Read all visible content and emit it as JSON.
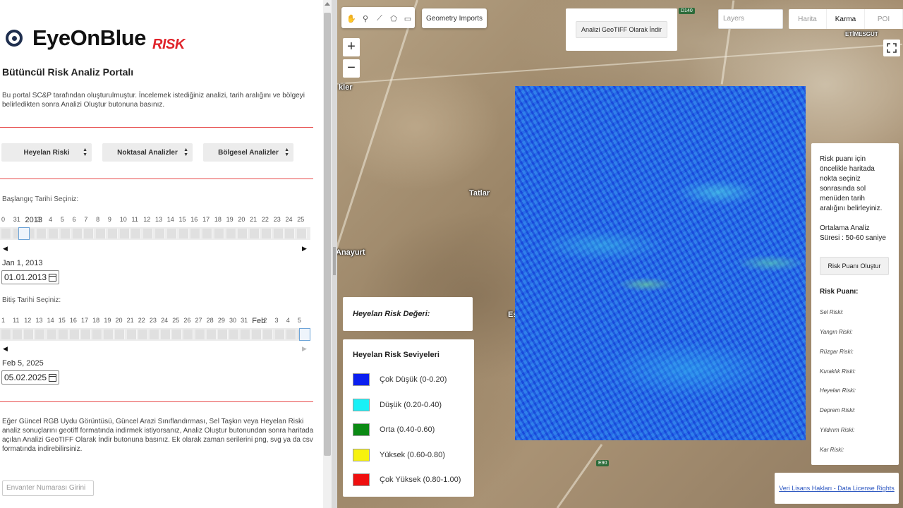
{
  "brand": {
    "name": "EyeOnBlue",
    "suffix": "RISK"
  },
  "portal": {
    "title": "Bütüncül Risk Analiz Portalı",
    "description": "Bu portal SC&P tarafından oluşturulmuştur. İncelemek istediğiniz analizi, tarih aralığını ve bölgeyi belirledikten sonra Analizi Oluştur butonuna basınız."
  },
  "dropdowns": [
    "Heyelan Riski",
    "Noktasal Analizler",
    "Bölgesel Analizler"
  ],
  "start": {
    "label": "Başlangıç Tarihi Seçiniz:",
    "ticks": [
      "0",
      "31",
      "2013",
      "3",
      "4",
      "5",
      "6",
      "7",
      "8",
      "9",
      "10",
      "11",
      "12",
      "13",
      "14",
      "15",
      "16",
      "17",
      "18",
      "19",
      "20",
      "21",
      "22",
      "23",
      "24",
      "25"
    ],
    "selected": "Jan 1, 2013",
    "input_value": "01.01.2013"
  },
  "end": {
    "label": "Bitiş Tarihi Seçiniz:",
    "ticks": [
      "1",
      "11",
      "12",
      "13",
      "14",
      "15",
      "16",
      "17",
      "18",
      "19",
      "20",
      "21",
      "22",
      "23",
      "24",
      "25",
      "26",
      "27",
      "28",
      "29",
      "30",
      "31",
      "Feb",
      "2",
      "3",
      "4",
      "5"
    ],
    "selected": "Feb 5, 2025",
    "input_value": "05.02.2025"
  },
  "footer_text": "Eğer Güncel RGB Uydu Görüntüsü, Güncel Arazi Sınıflandırması, Sel Taşkın veya Heyelan Riski analiz sonuçlarını geotiff formatında indirmek istiyorsanız, Analiz Oluştur butonundan sonra haritada açılan Analizi GeoTIFF Olarak İndir butonuna basınız. Ek olarak zaman serilerini png, svg ya da csv formatında indirebilirsiniz.",
  "inventory_placeholder": "Envanter Numarası Girini",
  "map": {
    "geometry_imports": "Geometry Imports",
    "geotiff_button": "Analizi GeoTIFF Olarak İndir",
    "layers_placeholder": "Layers",
    "basemaps": [
      "Harita",
      "Karma",
      "POI"
    ],
    "active_basemap": "Karma",
    "zoom_in": "+",
    "zoom_out": "−",
    "places": [
      "kler",
      "Tatlar",
      "Anayurt",
      "Es",
      "ETİMESGUT"
    ],
    "road_badges": [
      "D140",
      "E90"
    ],
    "license_link": "Veri Lisans Hakları - Data License Rights"
  },
  "legend_value_title": "Heyelan Risk Değeri:",
  "legend": {
    "title": "Heyelan Risk Seviyeleri",
    "items": [
      {
        "label": "Çok Düşük (0-0.20)",
        "color": "#0b1ff0"
      },
      {
        "label": "Düşük (0.20-0.40)",
        "color": "#19f0f6"
      },
      {
        "label": "Orta (0.40-0.60)",
        "color": "#0b8a14"
      },
      {
        "label": "Yüksek (0.60-0.80)",
        "color": "#f7f20e"
      },
      {
        "label": "Çok Yüksek (0.80-1.00)",
        "color": "#ef0f0f"
      }
    ]
  },
  "risk_panel": {
    "instructions": "Risk puanı için öncelikle haritada nokta seçiniz sonrasında sol menüden tarih aralığını belirleyiniz.",
    "duration": "Ortalama Analiz Süresi : 50-60 saniye",
    "button": "Risk Puanı Oluştur",
    "heading": "Risk Puanı:",
    "items": [
      "Sel Riski:",
      "Yangın Riski:",
      "Rüzgar Riski:",
      "Kuraklık Riski:",
      "Heyelan Riski:",
      "Deprem Riski:",
      "Yıldırım Riski:",
      "Kar Riski:"
    ]
  }
}
